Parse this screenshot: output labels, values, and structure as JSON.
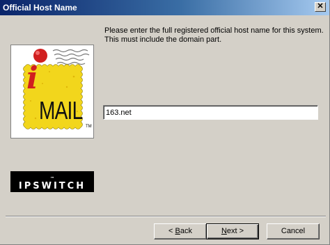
{
  "window": {
    "title": "Official Host Name",
    "close_glyph": "✕"
  },
  "prompt": {
    "line1": "Please enter the full registered official host name for this system.",
    "line2": "This must include the domain part."
  },
  "hostname_field": {
    "value": "163.net"
  },
  "logo": {
    "product_text": "MAIL",
    "product_prefix": "i",
    "trademark": "TM",
    "brand_text": "IPSWITCH",
    "brand_trademark": "™"
  },
  "buttons": {
    "back": {
      "prefix": "< ",
      "accel": "B",
      "rest": "ack"
    },
    "next": {
      "accel": "N",
      "rest": "ext >"
    },
    "cancel": {
      "label": "Cancel"
    }
  },
  "colors": {
    "titlebar_start": "#0a246a",
    "titlebar_end": "#a6caf0",
    "dialog_face": "#d4d0c8",
    "stamp_yellow": "#f2d61c",
    "logo_red": "#d11f1f"
  }
}
